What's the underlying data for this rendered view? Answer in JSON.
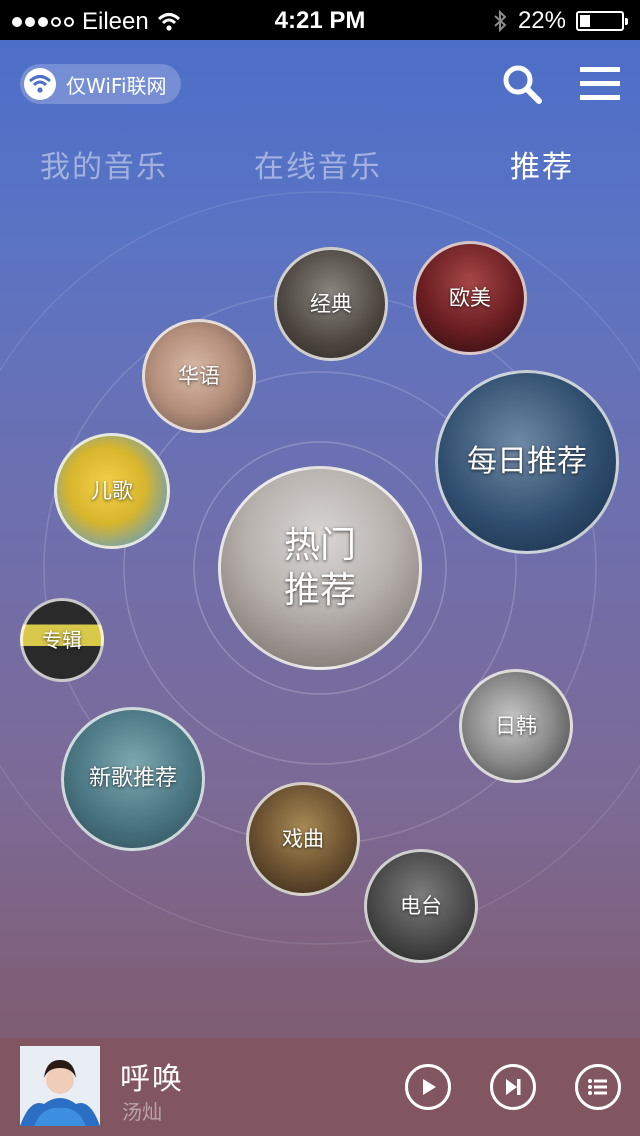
{
  "status_bar": {
    "carrier": "Eileen",
    "time": "4:21 PM",
    "battery": "22%",
    "battery_level": 0.22,
    "signal_bars": 3,
    "icons": [
      "signal-dots-icon",
      "wifi-icon",
      "bluetooth-icon",
      "battery-icon"
    ]
  },
  "header": {
    "wifi_only_label": "仅WiFi联网",
    "icons": [
      "wifi-icon",
      "search-icon",
      "menu-icon"
    ]
  },
  "tabs": [
    {
      "label": "我的音乐",
      "active": false
    },
    {
      "label": "在线音乐",
      "active": false
    },
    {
      "label": "推荐",
      "active": true
    }
  ],
  "categories": {
    "hot": "热门\n推荐",
    "daily": "每日推荐",
    "classic": "经典",
    "western": "欧美",
    "chinese": "华语",
    "kids": "儿歌",
    "album": "专辑",
    "new_songs": "新歌推荐",
    "opera": "戏曲",
    "jp_kr": "日韩",
    "radio": "电台"
  },
  "now_playing": {
    "title": "呼唤",
    "artist": "汤灿",
    "icons": [
      "play-icon",
      "next-icon",
      "playlist-icon"
    ]
  },
  "colors": {
    "accent": "#ffffff",
    "background_top": "#4a6cc9",
    "background_bottom": "#7c5a67",
    "player_bar": "#82555f"
  }
}
